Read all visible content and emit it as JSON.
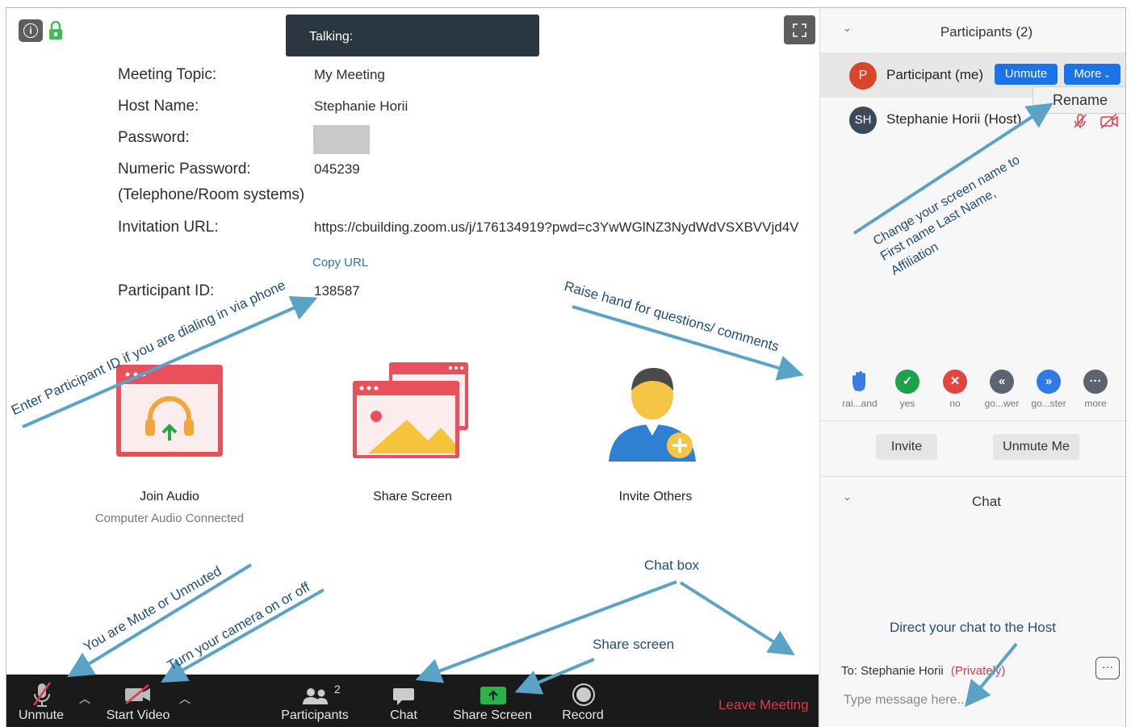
{
  "header": {
    "talking_label": "Talking:"
  },
  "meeting_info": {
    "topic_label": "Meeting Topic:",
    "topic_value": "My Meeting",
    "host_label": "Host Name:",
    "host_value": "Stephanie Horii",
    "password_label": "Password:",
    "numeric_password_label": "Numeric Password:",
    "numeric_password_sub": "(Telephone/Room systems)",
    "numeric_password_value": "045239",
    "invitation_label": "Invitation URL:",
    "invitation_value": "https://cbuilding.zoom.us/j/176134919?pwd=c3YwWGlNZ3NydWdVSXBVVjd4V",
    "copy_url": "Copy URL",
    "participant_id_label": "Participant ID:",
    "participant_id_value": "138587"
  },
  "tiles": [
    {
      "label": "Join Audio",
      "sub": "Computer Audio Connected"
    },
    {
      "label": "Share Screen"
    },
    {
      "label": "Invite Others"
    }
  ],
  "toolbar": {
    "unmute": "Unmute",
    "start_video": "Start Video",
    "participants": "Participants",
    "participants_count": "2",
    "chat": "Chat",
    "share_screen": "Share Screen",
    "record": "Record",
    "leave": "Leave Meeting"
  },
  "participants_panel": {
    "title": "Participants (2)",
    "me": {
      "initial": "P",
      "name": "Participant (me)",
      "unmute_btn": "Unmute",
      "more_btn": "More"
    },
    "rename_menu": "Rename",
    "host": {
      "initials": "SH",
      "name": "Stephanie Horii (Host)"
    },
    "reactions": [
      {
        "icon": "raise-hand-icon",
        "label": "rai...and",
        "color": "#3a7de0"
      },
      {
        "icon": "yes-icon",
        "label": "yes",
        "color": "#1aa34a"
      },
      {
        "icon": "no-icon",
        "label": "no",
        "color": "#e0463e"
      },
      {
        "icon": "go-slower-icon",
        "label": "go...wer",
        "color": "#5c6470"
      },
      {
        "icon": "go-faster-icon",
        "label": "go...ster",
        "color": "#2e7be6"
      },
      {
        "icon": "more-icon",
        "label": "more",
        "color": "#5c6470"
      }
    ],
    "invite_btn": "Invite",
    "unmute_me_btn": "Unmute Me"
  },
  "chat_panel": {
    "title": "Chat",
    "to_label": "To: Stephanie Horii",
    "privately": "(Privately)",
    "placeholder": "Type message here..."
  },
  "annotations": {
    "participant_id": "Enter Participant ID if you are dialing in via phone",
    "raise_hand": "Raise hand for questions/ comments",
    "rename_line1": "Change your screen name to",
    "rename_line2": "First name Last Name,",
    "rename_line3": "Affiliation",
    "mute": "You are Mute or Unmuted",
    "camera": "Turn your camera on or off",
    "chat_box": "Chat box",
    "share_screen": "Share screen",
    "direct_chat": "Direct your chat to the Host"
  },
  "colors": {
    "toolbar_bg": "#1a1a1a",
    "leave_red": "#e0384a",
    "accent_blue": "#1a73e8",
    "annotation_arrow": "#5ba3c6",
    "annotation_text": "#1f4e79"
  }
}
